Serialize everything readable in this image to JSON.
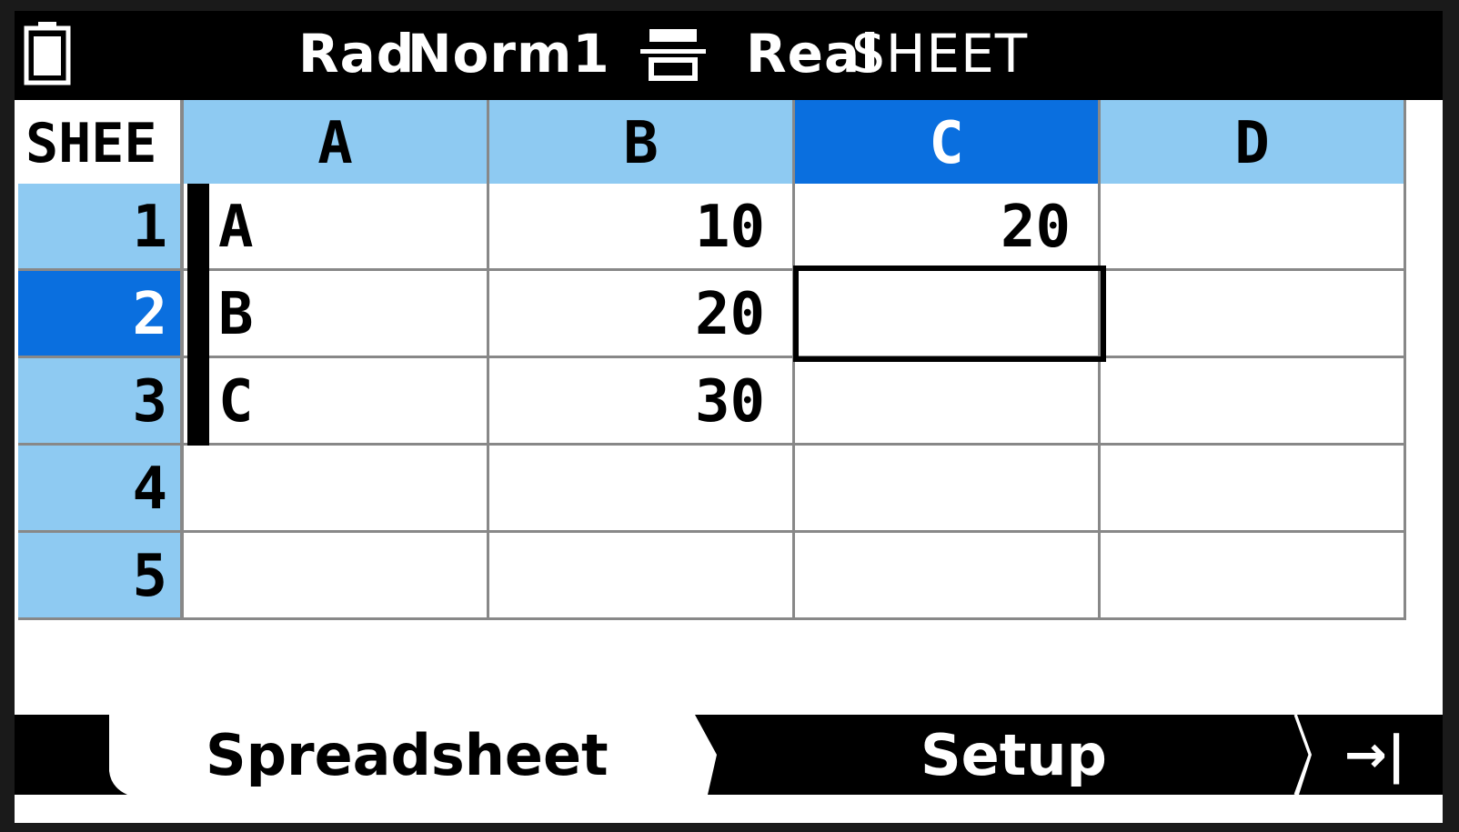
{
  "status_bar": {
    "angle_unit": "Rad",
    "display_format": "Norm1",
    "complex_mode": "Real",
    "app_mode": "SHEET"
  },
  "sheet": {
    "sheet_label": "SHEE",
    "columns": [
      "A",
      "B",
      "C",
      "D"
    ],
    "rows": [
      "1",
      "2",
      "3",
      "4",
      "5"
    ],
    "cells": [
      [
        "A",
        "10",
        "20",
        ""
      ],
      [
        "B",
        "20",
        "",
        ""
      ],
      [
        "C",
        "30",
        "",
        ""
      ],
      [
        "",
        "",
        "",
        ""
      ],
      [
        "",
        "",
        "",
        ""
      ]
    ],
    "selected_column": "C",
    "selected_row": "2"
  },
  "softkeys": {
    "spreadsheet": "Spreadsheet",
    "setup": "Setup",
    "next_icon": "→|"
  },
  "colors": {
    "header_fill": "#8ecaf2",
    "selection_fill": "#0a6fdf"
  }
}
